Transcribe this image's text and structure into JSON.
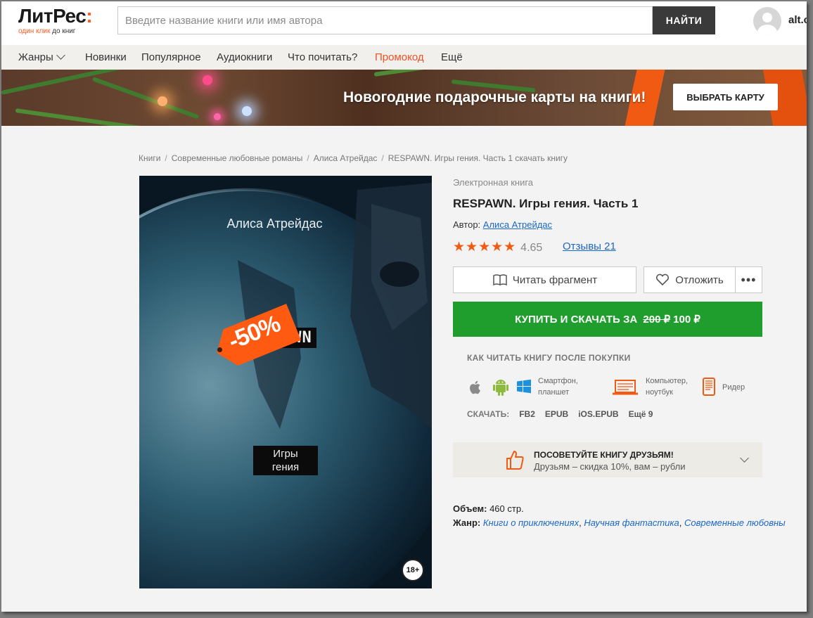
{
  "header": {
    "logo_name": "ЛитРес",
    "logo_colon": ":",
    "logo_tag_a": "один клик",
    "logo_tag_b": "до книг",
    "search_placeholder": "Введите название книги или имя автора",
    "search_button": "НАЙТИ",
    "user": "alt.c"
  },
  "nav": {
    "items": [
      "Жанры",
      "Новинки",
      "Популярное",
      "Аудиокниги",
      "Что почитать?",
      "Промокод",
      "Ещё"
    ]
  },
  "banner": {
    "text": "Новогодние подарочные карты на книги!",
    "button": "ВЫБРАТЬ КАРТУ"
  },
  "breadcrumb": [
    "Книги",
    "Современные любовные романы",
    "Алиса Атрейдас",
    "RESPAWN. Игры гения. Часть 1 скачать книгу"
  ],
  "cover": {
    "author": "Алиса Атрейдас",
    "title": "RESPAWN",
    "subtitle_1": "Игры",
    "subtitle_2": "гения",
    "sale": "-50%",
    "age": "18+"
  },
  "book": {
    "kind": "Электронная книга",
    "title": "RESPAWN. Игры гения. Часть 1",
    "author_label": "Автор:",
    "author": "Алиса Атрейдас",
    "stars": "★★★★★",
    "rating": "4.65",
    "reviews": "Отзывы 21",
    "read_button": "Читать фрагмент",
    "shelf_button": "Отложить",
    "more_button": "•••",
    "buy_prefix": "КУПИТЬ И СКАЧАТЬ ЗА",
    "old_price": "200 ₽",
    "price": "100 ₽"
  },
  "reading": {
    "howto": "КАК ЧИТАТЬ КНИГУ ПОСЛЕ ПОКУПКИ",
    "smartphone_1": "Смартфон,",
    "smartphone_2": "планшет",
    "computer_1": "Компьютер,",
    "computer_2": "ноутбук",
    "reader": "Ридер",
    "download_label": "СКАЧАТЬ:",
    "formats": [
      "FB2",
      "EPUB",
      "iOS.EPUB",
      "Ещё 9"
    ]
  },
  "share": {
    "title": "ПОСОВЕТУЙТЕ КНИГУ ДРУЗЬЯМ!",
    "subtitle": "Друзьям – скидка 10%, вам – рубли"
  },
  "details": {
    "volume_label": "Объем:",
    "volume": "460 стр.",
    "genre_label": "Жанр:",
    "genres": [
      "Книги о приключениях",
      "Научная фантастика",
      "Современные любовны"
    ]
  },
  "colors": {
    "accent": "#f05123",
    "buy": "#209e2d",
    "link": "#1a66c9"
  }
}
